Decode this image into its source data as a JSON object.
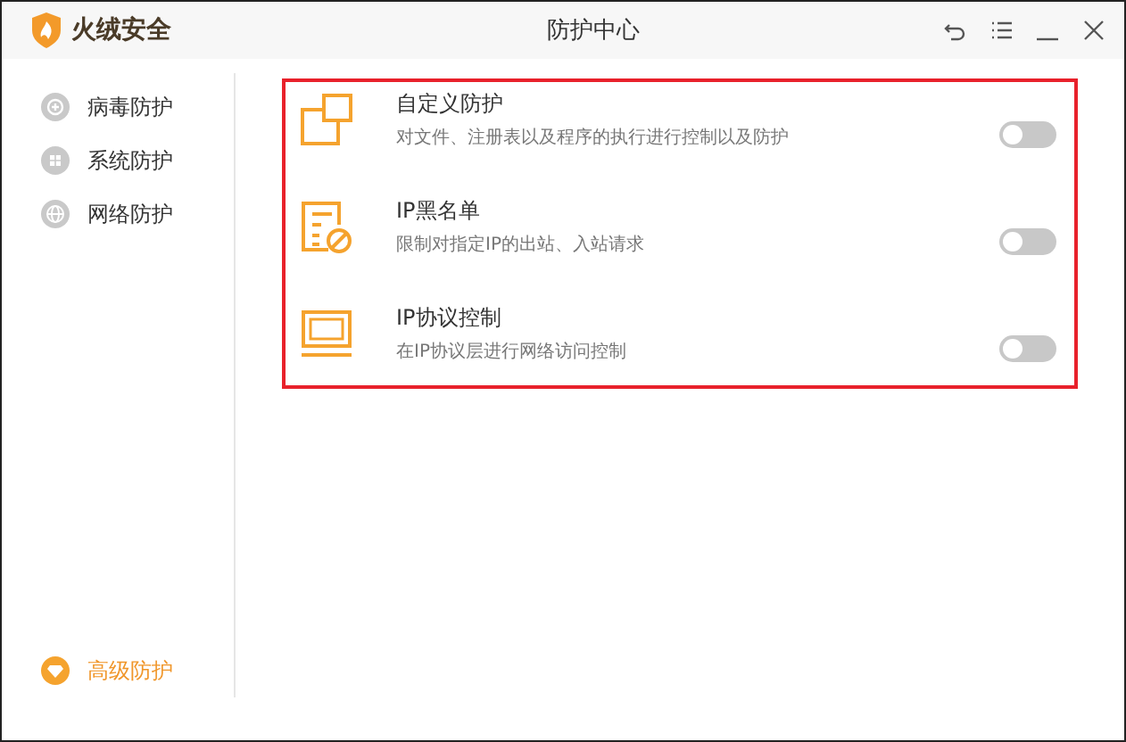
{
  "window": {
    "app_name": "火绒安全",
    "title": "防护中心"
  },
  "sidebar": {
    "items": [
      {
        "label": "病毒防护",
        "selected": false
      },
      {
        "label": "系统防护",
        "selected": false
      },
      {
        "label": "网络防护",
        "selected": false
      }
    ],
    "bottom_items": [
      {
        "label": "高级防护",
        "selected": true
      }
    ]
  },
  "features": [
    {
      "title": "自定义防护",
      "description": "对文件、注册表以及程序的执行进行控制以及防护",
      "on": false
    },
    {
      "title": "IP黑名单",
      "description": "限制对指定IP的出站、入站请求",
      "on": false
    },
    {
      "title": "IP协议控制",
      "description": "在IP协议层进行网络访问控制",
      "on": false
    }
  ]
}
